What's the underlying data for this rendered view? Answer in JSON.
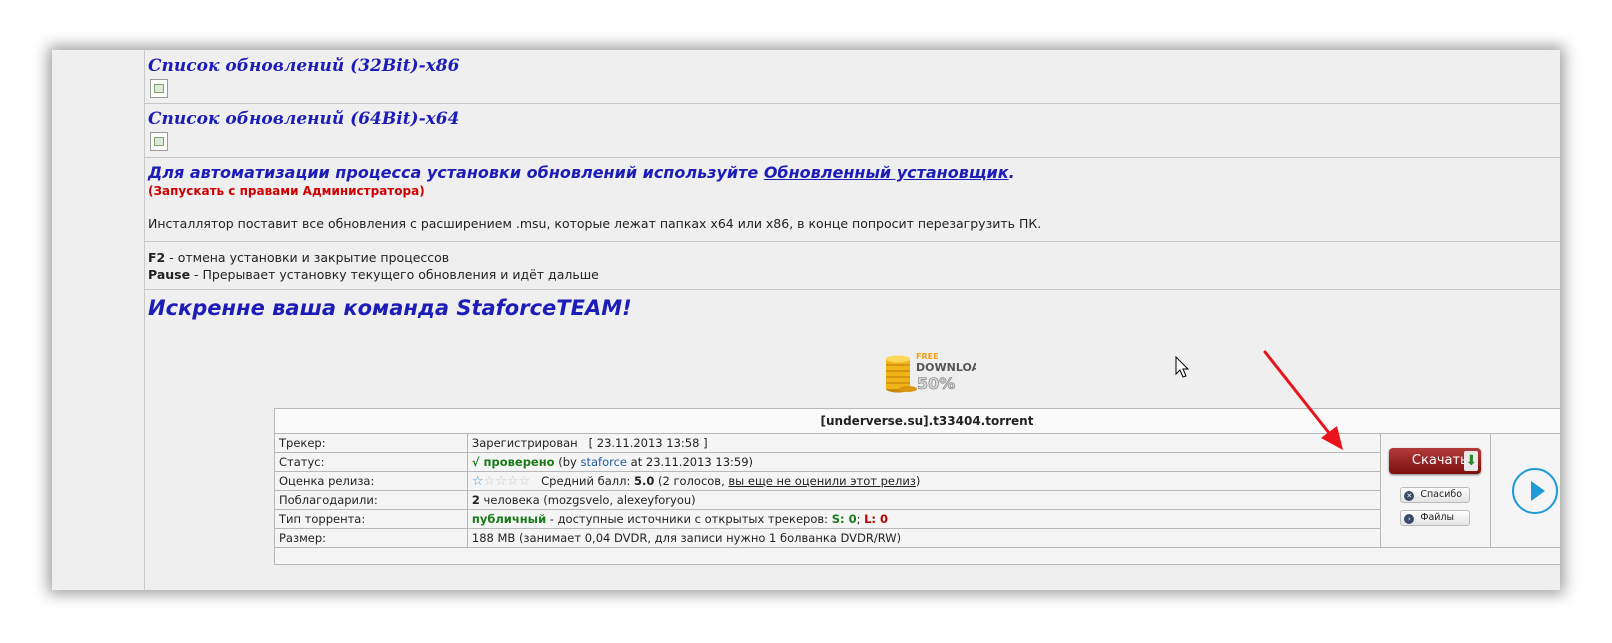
{
  "updates_32": "Список обновлений (32Bit)-x86",
  "updates_64": "Список обновлений (64Bit)-x64",
  "auto_prefix": "Для автоматизации процесса установки обновлений используйте ",
  "auto_link": "Обновленный установщик",
  "auto_suffix": ".",
  "admin_note": "(Запускать с правами Администратора)",
  "installer_desc": "Инсталлятор поставит все обновления с расширением .msu, которые лежат папках x64 или x86, в конце попросит перезагрузить ПК.",
  "keys": {
    "f2_key": "F2",
    "f2_desc": " - отмена установки и закрытие процессов",
    "pause_key": "Pause",
    "pause_desc": " - Прерывает установку текущего обновления и идёт дальше"
  },
  "signature": "Искренне ваша команда StaforceTEAM!",
  "free_download": {
    "line1": "FREE",
    "line2": "DOWNLOAD",
    "line3": "50%"
  },
  "torrent": {
    "filename": "[underverse.su].t33404.torrent",
    "rows": {
      "tracker_label": "Трекер:",
      "tracker_value": "Зарегистрирован   [ 23.11.2013 13:58 ]",
      "status_label": "Статус:",
      "status_check": "√ проверено",
      "status_by": " (by ",
      "status_user": "staforce",
      "status_date": " at 23.11.2013 13:59)",
      "rating_label": "Оценка релиза:",
      "rating_avg_label": "Средний балл: ",
      "rating_avg": "5.0",
      "rating_votes": " (2 голосов, ",
      "rating_link": "вы еще не оценили этот релиз",
      "rating_close": ")",
      "thanks_label": "Поблагодарили:",
      "thanks_count": "2",
      "thanks_rest": " человека (mozgsvelo, alexeyforyou)",
      "type_label": "Тип торрента:",
      "type_public": "публичный",
      "type_desc": " - доступные источники с открытых трекеров: ",
      "type_s": "S: 0",
      "type_sep": "; ",
      "type_l": "L: 0",
      "size_label": "Размер:",
      "size_value": "188 MB (занимает 0,04 DVDR, для записи нужно 1 болванка DVDR/RW)"
    },
    "download_button": "Скачать",
    "thanks_button": "Спасибо",
    "files_button": "Файлы"
  },
  "rating_stars": 1,
  "colors": {
    "link_blue": "#1c1cb8",
    "note_red": "#d10000",
    "arrow_red": "#e8141a",
    "play_blue": "#1e9ad6"
  }
}
